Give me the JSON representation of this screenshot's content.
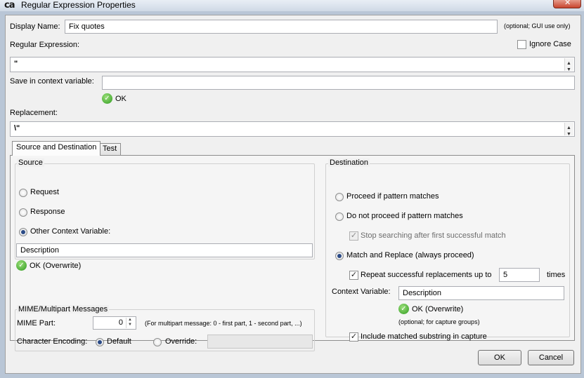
{
  "window": {
    "logo_text": "ca",
    "title": "Regular Expression Properties",
    "close_symbol": "✕"
  },
  "form": {
    "display_name_label": "Display Name:",
    "display_name_value": "Fix quotes",
    "display_name_hint": "(optional; GUI use only)",
    "regex_label": "Regular Expression:",
    "ignore_case_label": "Ignore Case",
    "ignore_case_checked": false,
    "regex_value": "\"",
    "save_context_label": "Save in context variable:",
    "save_context_value": "",
    "save_context_status": "OK",
    "replacement_label": "Replacement:",
    "replacement_value": "\\\""
  },
  "tabs": [
    {
      "label": "Source and Destination",
      "active": true
    },
    {
      "label": "Test",
      "active": false
    }
  ],
  "source": {
    "legend": "Source",
    "options": [
      {
        "label": "Request",
        "selected": false
      },
      {
        "label": "Response",
        "selected": false
      },
      {
        "label": "Other Context Variable:",
        "selected": true
      }
    ],
    "variable_value": "Description",
    "variable_status": "OK (Overwrite)"
  },
  "mime": {
    "legend": "MIME/Multipart Messages",
    "part_label": "MIME Part:",
    "part_value": "0",
    "part_hint": "(For multipart message: 0 - first part, 1 - second part, ...)",
    "encoding_label": "Character Encoding:",
    "default_label": "Default",
    "default_selected": true,
    "override_label": "Override:",
    "override_value": ""
  },
  "destination": {
    "legend": "Destination",
    "proceed_label": "Proceed if pattern matches",
    "no_proceed_label": "Do not proceed if pattern matches",
    "stop_search_label": "Stop searching after first successful match",
    "match_replace_label": "Match and Replace (always proceed)",
    "match_replace_selected": true,
    "repeat_label": "Repeat successful replacements up to",
    "repeat_value": "5",
    "repeat_unit": "times",
    "context_var_label": "Context Variable:",
    "context_var_value": "Description",
    "context_var_status": "OK (Overwrite)",
    "context_var_hint": "(optional; for capture groups)",
    "include_label": "Include matched substring in capture"
  },
  "buttons": {
    "ok": "OK",
    "cancel": "Cancel"
  },
  "icons": {
    "ok_status_icon": "check-circle-icon",
    "check_mark": "✓",
    "ok_glyph": "✓"
  },
  "colors": {
    "status_ok_green": "#2f9a1f",
    "dialog_bg": "#f0f0f0"
  }
}
